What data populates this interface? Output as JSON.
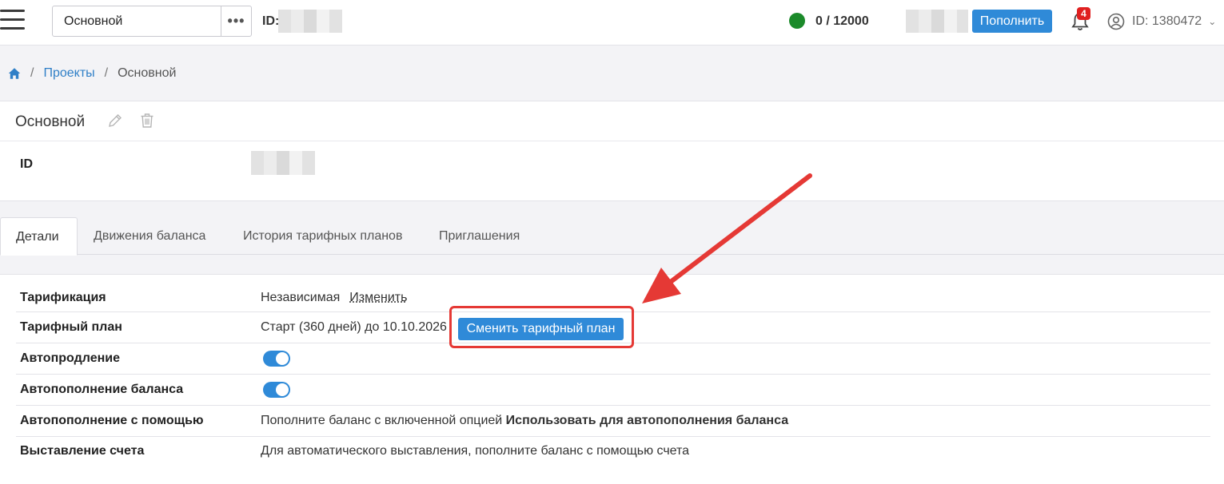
{
  "topbar": {
    "project_value": "Основной",
    "more_label": "•••",
    "id_label": "ID:",
    "balance": "0 / 12000",
    "topup_label": "Пополнить",
    "notifications_count": "4",
    "user_id": "ID: 1380472",
    "status_color": "#1b8a2a",
    "accent_color": "#2f8ad8"
  },
  "breadcrumb": {
    "home_icon": "home-icon",
    "items": [
      "Проекты",
      "Основной"
    ]
  },
  "project": {
    "title": "Основной",
    "id_label": "ID"
  },
  "tabs": [
    {
      "label": "Детали",
      "active": true
    },
    {
      "label": "Движения баланса",
      "active": false
    },
    {
      "label": "История тарифных планов",
      "active": false
    },
    {
      "label": "Приглашения",
      "active": false
    }
  ],
  "details": {
    "rows": [
      {
        "label": "Тарификация",
        "value": "Независимая",
        "link": "Изменить"
      },
      {
        "label": "Тарифный план",
        "value": "Старт (360 дней) до 10.10.2026",
        "button": "Сменить тарифный план"
      },
      {
        "label": "Автопродление",
        "toggle": true
      },
      {
        "label": "Автопополнение баланса",
        "toggle": true
      },
      {
        "label": "Автопополнение с помощью",
        "value": "Пополните баланс с включенной опцией ",
        "value_bold": "Использовать для автопополнения баланса"
      },
      {
        "label": "Выставление счета",
        "value": "Для автоматического выставления, пополните баланс с помощью счета"
      }
    ]
  },
  "annotation_color": "#e53935"
}
